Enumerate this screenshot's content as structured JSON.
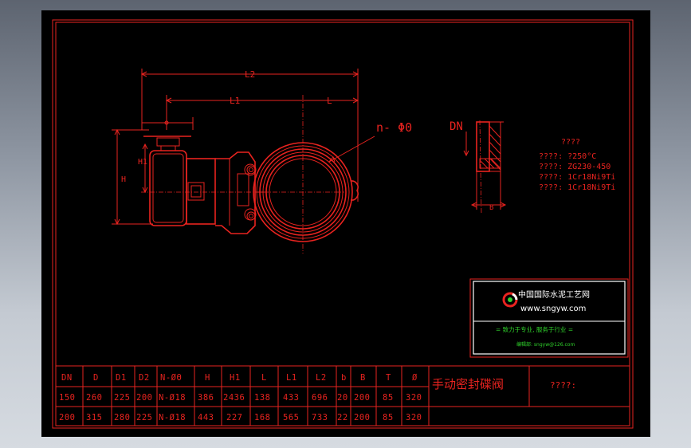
{
  "dims": {
    "L2": "L2",
    "L1": "L1",
    "L": "L",
    "H": "H",
    "H1": "H1",
    "hole": "n- Φ0",
    "DN": "DN",
    "B": "B"
  },
  "notes": {
    "title": "????",
    "lines": [
      "????: ?250°C",
      "????: ZG230-450",
      "????: 1Cr18Ni9Ti",
      "????: 1Cr18Ni9Ti"
    ]
  },
  "logo": {
    "cn_name": "中国国际水泥工艺网",
    "url": "www.sngyw.com",
    "slogan": "= 致力于专业, 服务于行业 =",
    "contact": "编辑部: sngyw@126.com"
  },
  "table": {
    "headers": [
      "DN",
      "D",
      "D1",
      "D2",
      "N-ØΘ",
      "H",
      "H1",
      "L",
      "L1",
      "L2",
      "b",
      "B",
      "T",
      "Ø"
    ],
    "rows": [
      [
        "150",
        "260",
        "225",
        "200",
        "N-Ø18",
        "386",
        "2436",
        "138",
        "433",
        "696",
        "20",
        "200",
        "85",
        "320"
      ],
      [
        "200",
        "315",
        "280",
        "225",
        "N-Ø18",
        "443",
        "227",
        "168",
        "565",
        "733",
        "22",
        "200",
        "85",
        "320"
      ]
    ],
    "title": "手动密封碟阀",
    "drawing_no": "????:"
  },
  "colors": {
    "background": "#000000",
    "line": "#e8231f",
    "logo_border": "#ffffff",
    "logo_green": "#2fd12b"
  }
}
